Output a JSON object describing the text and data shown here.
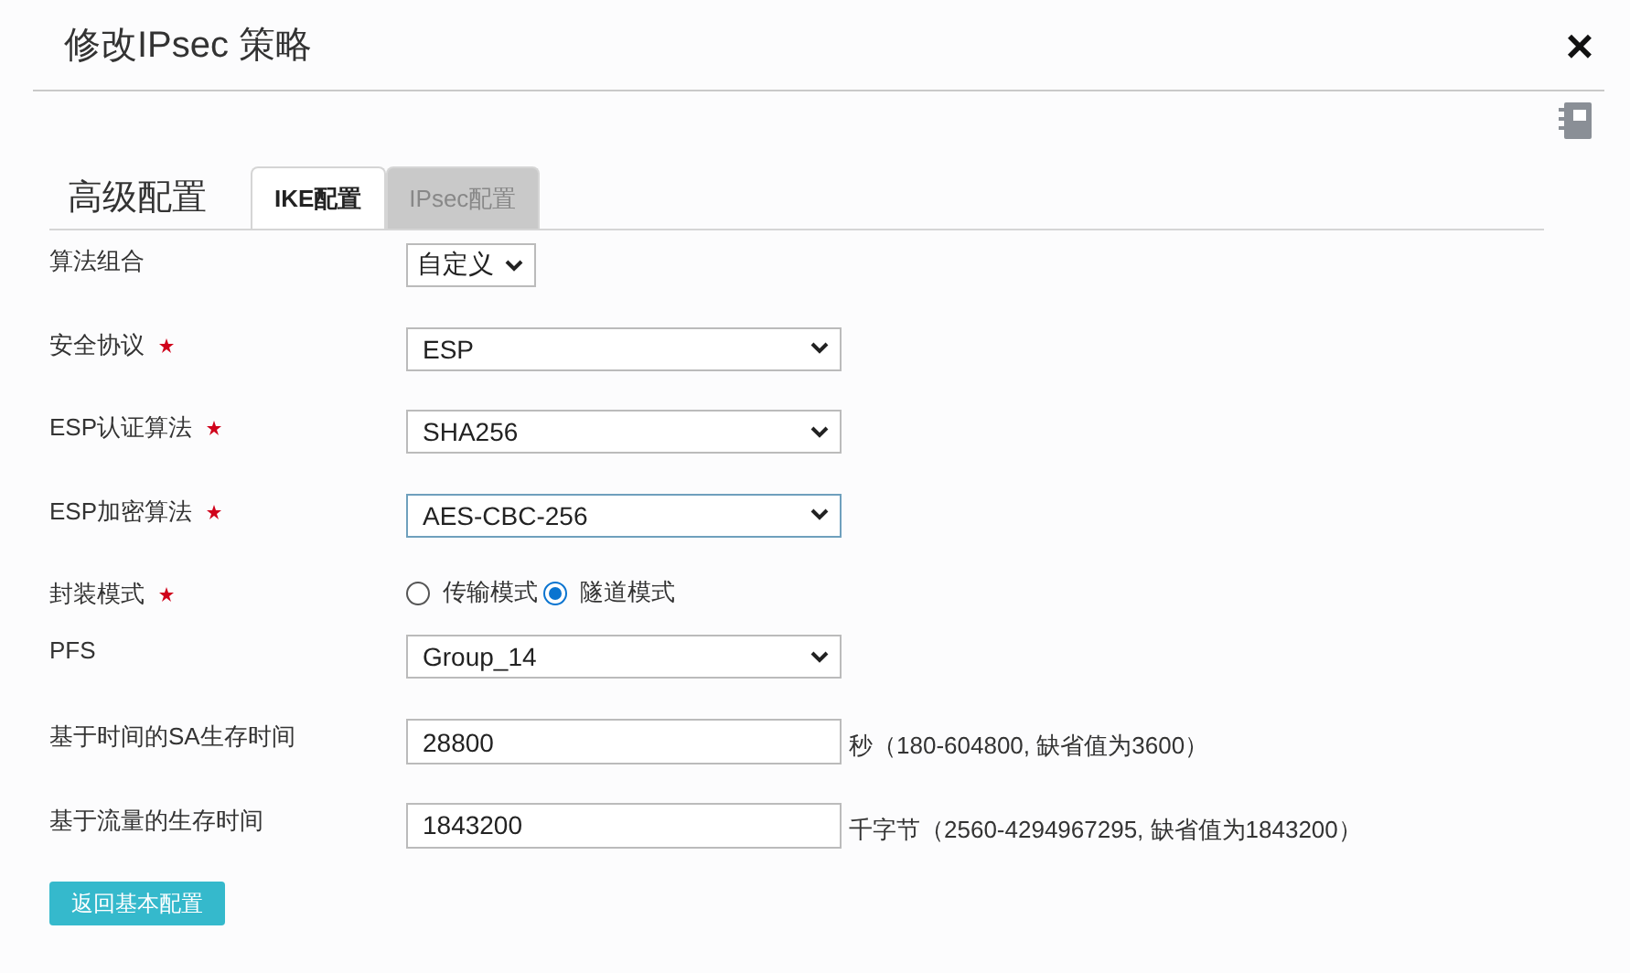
{
  "dialog": {
    "title": "修改IPsec 策略",
    "close": "×"
  },
  "section": {
    "title": "高级配置"
  },
  "tabs": [
    {
      "label": "IKE配置",
      "selected": true
    },
    {
      "label": "IPsec配置",
      "selected": false
    }
  ],
  "fields": [
    {
      "kind": "select",
      "label": "算法组合",
      "required": false,
      "value": "自定义",
      "compact": true,
      "focused": false
    },
    {
      "kind": "select",
      "label": "安全协议",
      "required": true,
      "value": "ESP",
      "compact": false,
      "focused": false
    },
    {
      "kind": "select",
      "label": "ESP认证算法",
      "required": true,
      "value": "SHA256",
      "compact": false,
      "focused": false
    },
    {
      "kind": "select",
      "label": "ESP加密算法",
      "required": true,
      "value": "AES-CBC-256",
      "compact": false,
      "focused": true
    },
    {
      "kind": "radio",
      "label": "封装模式",
      "required": true,
      "options": [
        {
          "label": "传输模式",
          "selected": false
        },
        {
          "label": "隧道模式",
          "selected": true
        }
      ]
    },
    {
      "kind": "select",
      "label": "PFS",
      "required": false,
      "value": "Group_14",
      "compact": false,
      "focused": false
    },
    {
      "kind": "input",
      "label": "基于时间的SA生存时间",
      "required": false,
      "value": "28800",
      "hint": "秒（180-604800, 缺省值为3600）"
    },
    {
      "kind": "input",
      "label": "基于流量的生存时间",
      "required": false,
      "value": "1843200",
      "hint": "千字节（2560-4294967295, 缺省值为1843200）"
    }
  ],
  "back_button": "返回基本配置"
}
